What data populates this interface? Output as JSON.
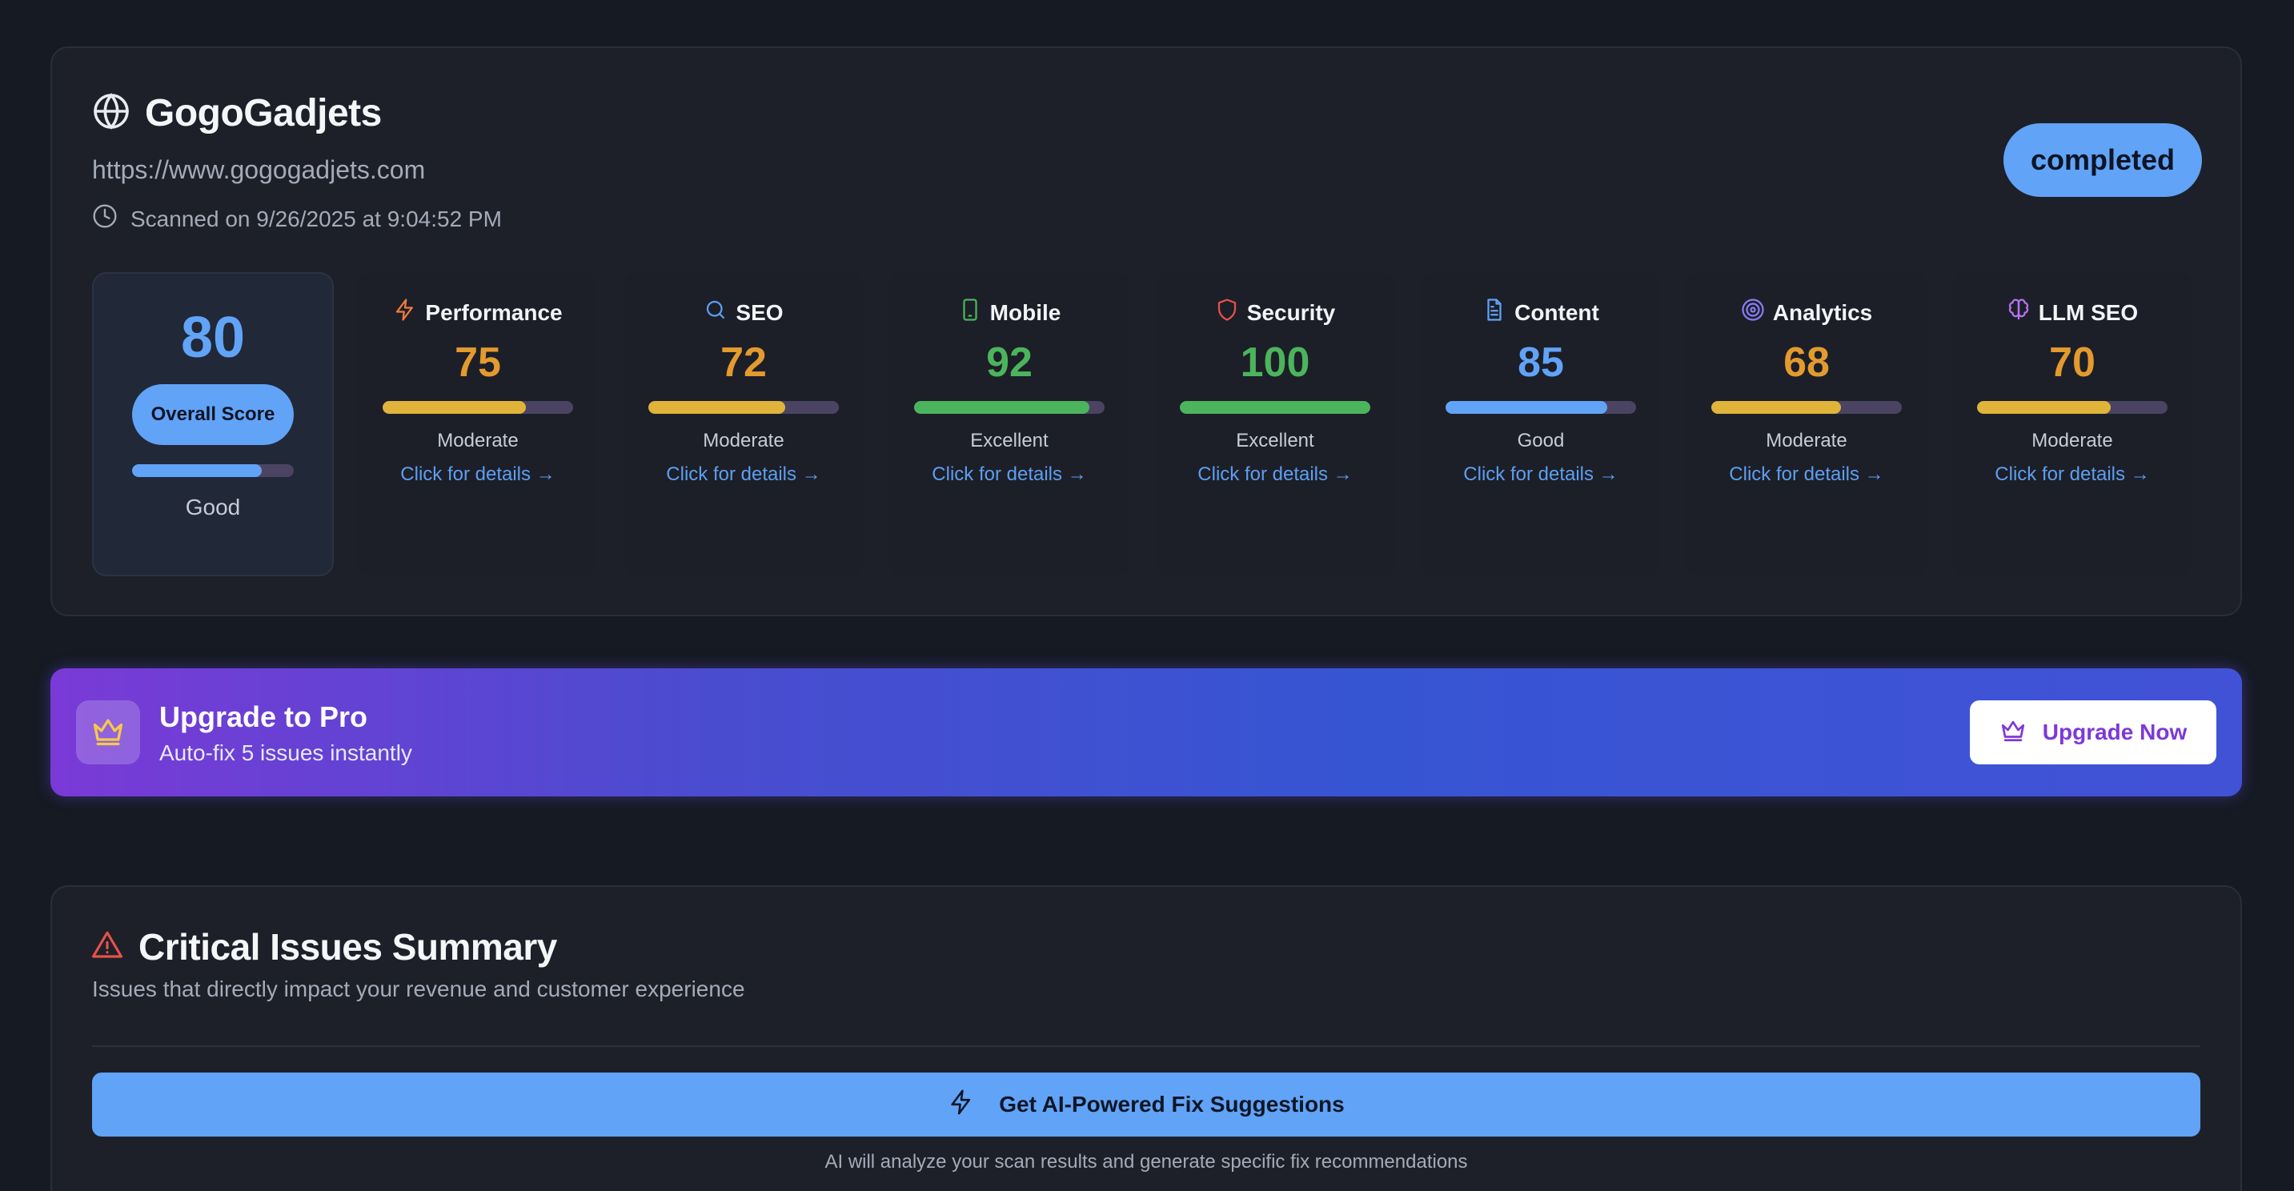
{
  "site": {
    "name": "GogoGadjets",
    "url": "https://www.gogogadjets.com",
    "scanned": "Scanned on 9/26/2025 at 9:04:52 PM",
    "status": "completed"
  },
  "overall": {
    "value": "80",
    "label": "Overall Score",
    "rating": "Good",
    "percent": 80,
    "color": "#61a3f7"
  },
  "categories": [
    {
      "name": "Performance",
      "icon": "lightning-icon",
      "value": "75",
      "percent": 75,
      "rating": "Moderate",
      "link": "Click for details →",
      "color": "#e0b33a",
      "value_color": "#e39a2e",
      "icon_color": "#f07c3a"
    },
    {
      "name": "SEO",
      "icon": "search-icon",
      "value": "72",
      "percent": 72,
      "rating": "Moderate",
      "link": "Click for details →",
      "color": "#e0b33a",
      "value_color": "#e39a2e",
      "icon_color": "#5e9ef0"
    },
    {
      "name": "Mobile",
      "icon": "smartphone-icon",
      "value": "92",
      "percent": 92,
      "rating": "Excellent",
      "link": "Click for details →",
      "color": "#4cb45c",
      "value_color": "#4cb45c",
      "icon_color": "#4cb45c"
    },
    {
      "name": "Security",
      "icon": "shield-icon",
      "value": "100",
      "percent": 100,
      "rating": "Excellent",
      "link": "Click for details →",
      "color": "#4cb45c",
      "value_color": "#4cb45c",
      "icon_color": "#e8514a"
    },
    {
      "name": "Content",
      "icon": "document-icon",
      "value": "85",
      "percent": 85,
      "rating": "Good",
      "link": "Click for details →",
      "color": "#61a3f7",
      "value_color": "#61a3f7",
      "icon_color": "#61a3f7"
    },
    {
      "name": "Analytics",
      "icon": "target-icon",
      "value": "68",
      "percent": 68,
      "rating": "Moderate",
      "link": "Click for details →",
      "color": "#e0b33a",
      "value_color": "#e39a2e",
      "icon_color": "#8a7cf4"
    },
    {
      "name": "LLM SEO",
      "icon": "brain-icon",
      "value": "70",
      "percent": 70,
      "rating": "Moderate",
      "link": "Click for details →",
      "color": "#e0b33a",
      "value_color": "#e39a2e",
      "icon_color": "#b374f2"
    }
  ],
  "upgrade": {
    "title": "Upgrade to Pro",
    "subtitle": "Auto-fix 5 issues instantly",
    "button": "Upgrade Now"
  },
  "issues": {
    "title": "Critical Issues Summary",
    "subtitle": "Issues that directly impact your revenue and customer experience",
    "ai_button": "Get AI-Powered Fix Suggestions",
    "ai_note": "AI will analyze your scan results and generate specific fix recommendations"
  },
  "colors": {
    "accent": "#61a3f7",
    "bar_track": "#4a4462",
    "warning": "#e8514a"
  }
}
